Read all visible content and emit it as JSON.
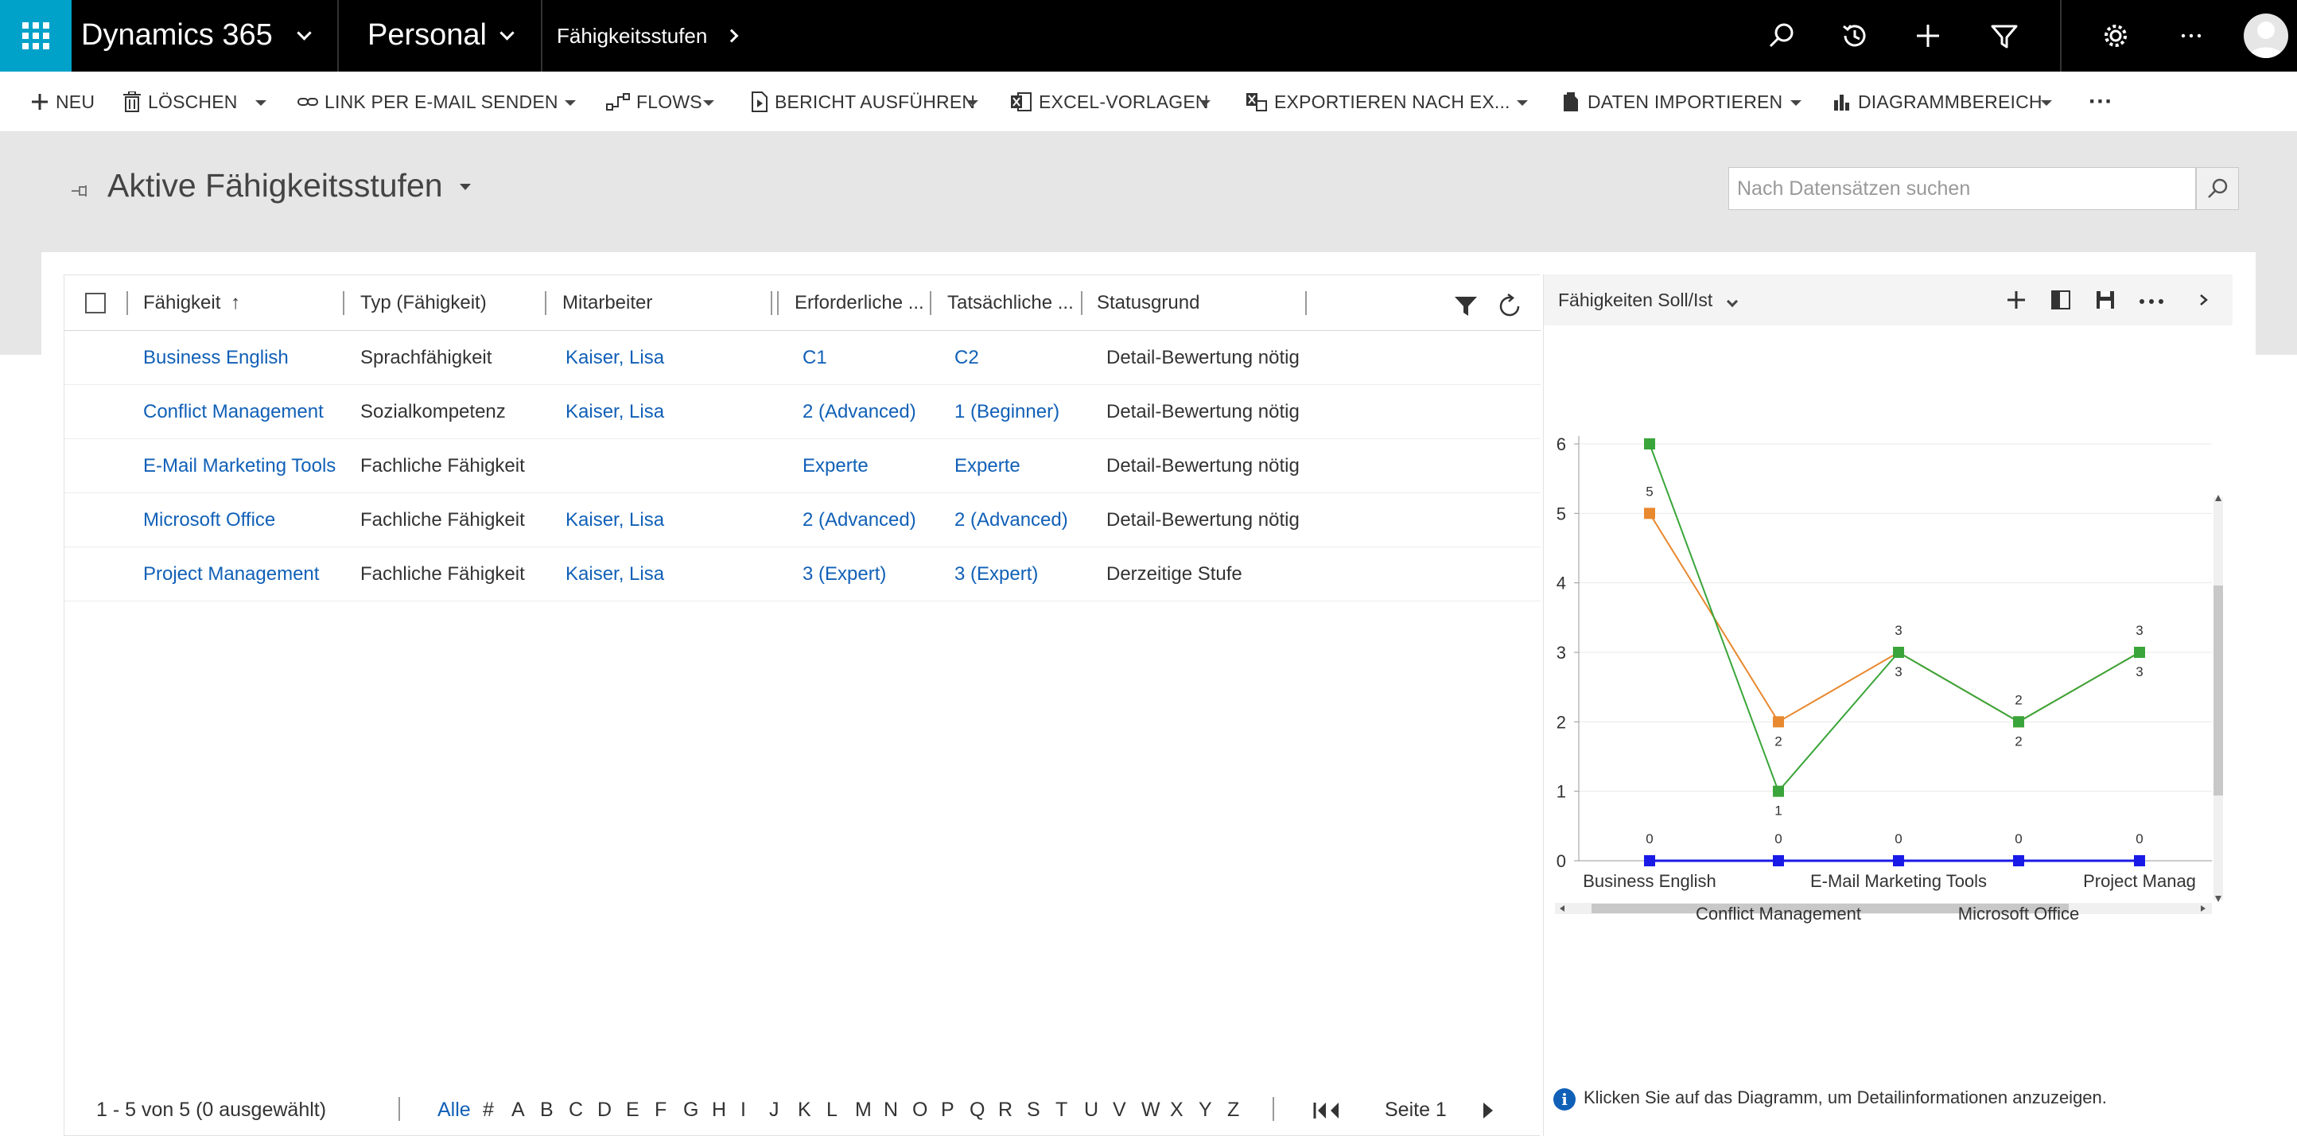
{
  "topbar": {
    "brand": "Dynamics 365",
    "app": "Personal",
    "breadcrumb": "Fähigkeitsstufen"
  },
  "commands": {
    "new": "NEU",
    "delete": "LÖSCHEN",
    "email_link": "LINK PER E-MAIL SENDEN",
    "flows": "FLOWS",
    "run_report": "BERICHT AUSFÜHREN",
    "excel_templates": "EXCEL-VORLAGEN",
    "export_excel": "EXPORTIEREN NACH EX...",
    "import_data": "DATEN IMPORTIEREN",
    "chart_pane": "DIAGRAMMBEREICH",
    "more": "···"
  },
  "view": {
    "title": "Aktive Fähigkeitsstufen",
    "search_placeholder": "Nach Datensätzen suchen"
  },
  "grid": {
    "columns": {
      "skill": "Fähigkeit",
      "type": "Typ (Fähigkeit)",
      "employee": "Mitarbeiter",
      "required": "Erforderliche ...",
      "actual": "Tatsächliche ...",
      "status": "Statusgrund"
    },
    "rows": [
      {
        "skill": "Business English",
        "type": "Sprachfähigkeit",
        "employee": "Kaiser, Lisa",
        "required": "C1",
        "actual": "C2",
        "status": "Detail-Bewertung nötig"
      },
      {
        "skill": "Conflict Management",
        "type": "Sozialkompetenz",
        "employee": "Kaiser, Lisa",
        "required": "2 (Advanced)",
        "actual": "1 (Beginner)",
        "status": "Detail-Bewertung nötig"
      },
      {
        "skill": "E-Mail Marketing Tools",
        "type": "Fachliche Fähigkeit",
        "employee": "",
        "required": "Experte",
        "actual": "Experte",
        "status": "Detail-Bewertung nötig"
      },
      {
        "skill": "Microsoft Office",
        "type": "Fachliche Fähigkeit",
        "employee": "Kaiser, Lisa",
        "required": "2 (Advanced)",
        "actual": "2 (Advanced)",
        "status": "Detail-Bewertung nötig"
      },
      {
        "skill": "Project Management",
        "type": "Fachliche Fähigkeit",
        "employee": "Kaiser, Lisa",
        "required": "3 (Expert)",
        "actual": "3 (Expert)",
        "status": "Derzeitige Stufe"
      }
    ],
    "footer": {
      "count": "1 - 5  von 5 (0 ausgewählt)",
      "alpha_all": "Alle",
      "alphabet": [
        "#",
        "A",
        "B",
        "C",
        "D",
        "E",
        "F",
        "G",
        "H",
        "I",
        "J",
        "K",
        "L",
        "M",
        "N",
        "O",
        "P",
        "Q",
        "R",
        "S",
        "T",
        "U",
        "V",
        "W",
        "X",
        "Y",
        "Z"
      ],
      "page": "Seite 1"
    }
  },
  "chart_panel": {
    "title": "Fähigkeiten Soll/Ist",
    "info": "Klicken Sie auf das Diagramm, um Detailinformationen anzuzeigen."
  },
  "chart_data": {
    "type": "line",
    "categories": [
      "Business English",
      "Conflict Management",
      "E-Mail Marketing Tools",
      "Microsoft Office",
      "Project Manag"
    ],
    "ylim": [
      0,
      6
    ],
    "yticks": [
      0,
      1,
      2,
      3,
      4,
      5,
      6
    ],
    "series": [
      {
        "color": "#e8892f",
        "values": [
          5,
          2,
          3,
          2,
          3
        ]
      },
      {
        "color": "#3aa53a",
        "values": [
          6,
          1,
          3,
          2,
          3
        ]
      },
      {
        "color": "#1a1ae6",
        "values": [
          0,
          0,
          0,
          0,
          0
        ]
      }
    ],
    "data_labels": {
      "above": [
        5,
        3,
        2,
        3
      ],
      "below": [
        2,
        1,
        3,
        2,
        3
      ],
      "zero": [
        0,
        0,
        0,
        0,
        0
      ]
    }
  }
}
